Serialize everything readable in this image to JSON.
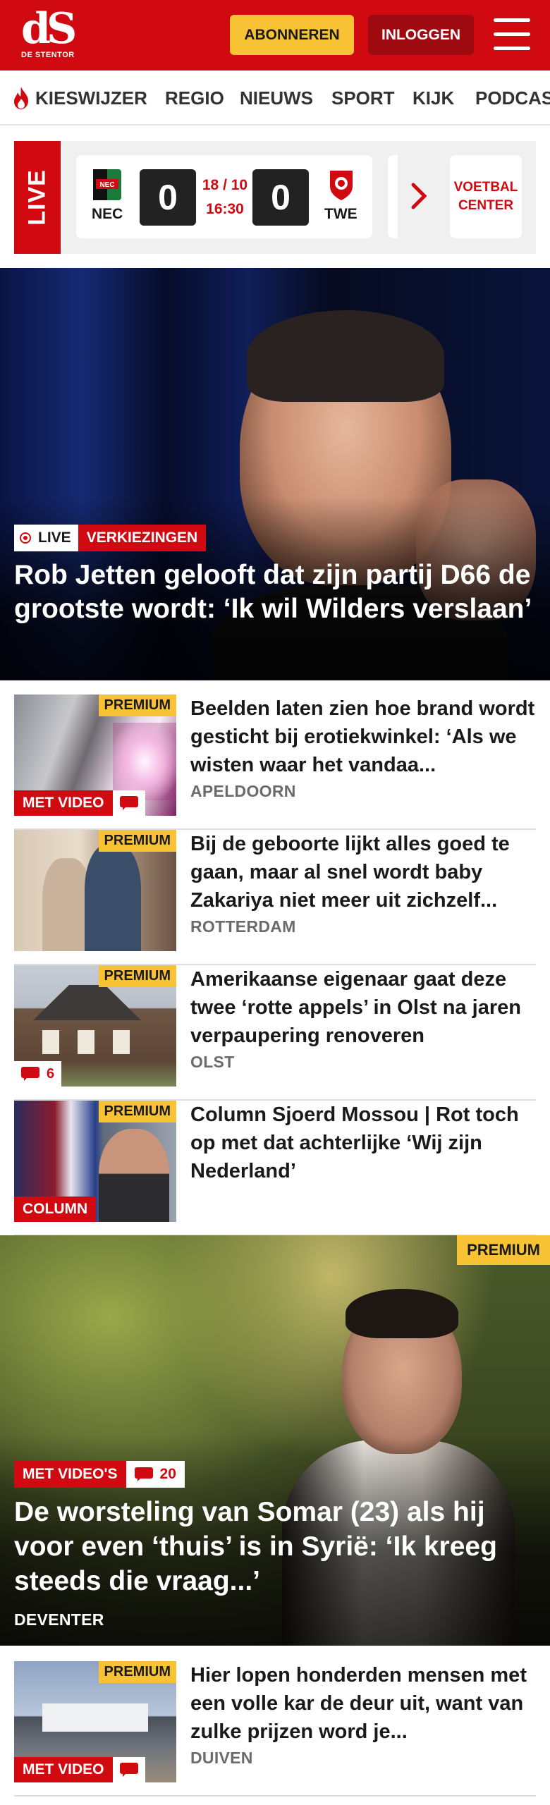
{
  "header": {
    "logo_mark": "dS",
    "logo_name": "DE STENTOR",
    "subscribe_label": "ABONNEREN",
    "login_label": "INLOGGEN",
    "brand_color": "#d10a11",
    "accent_color": "#f7c233"
  },
  "nav": {
    "items": [
      "KIESWIJZER",
      "REGIO",
      "NIEUWS",
      "SPORT",
      "KIJK",
      "PODCASTS"
    ]
  },
  "live": {
    "label": "LIVE",
    "match": {
      "home_team": "NEC",
      "away_team": "TWE",
      "home_score": "0",
      "away_score": "0",
      "date": "18 / 10",
      "time": "16:30"
    },
    "voetbal_center": "VOETBAL CENTER"
  },
  "hero": {
    "live_tag": "LIVE",
    "category": "VERKIEZINGEN",
    "title": "Rob Jetten gelooft dat zijn partij D66 de grootste wordt: ‘Ik wil Wilders verslaan’"
  },
  "articles": [
    {
      "title": "Beelden laten zien hoe brand wordt gesticht bij erotiekwinkel: ‘Als we wisten waar het vandaa...",
      "location": "APELDOORN",
      "premium": "PREMIUM",
      "badge": "MET VIDEO",
      "comments": ""
    },
    {
      "title": "Bij de geboorte lijkt alles goed te gaan, maar al snel wordt baby Zakariya niet meer uit zichzelf...",
      "location": "ROTTERDAM",
      "premium": "PREMIUM",
      "badge": "",
      "comments": ""
    },
    {
      "title": "Amerikaanse eigenaar gaat deze twee ‘rotte appels’ in Olst na jaren verpaupering renoveren",
      "location": "OLST",
      "premium": "PREMIUM",
      "badge": "",
      "comments": "6"
    },
    {
      "title": "Column Sjoerd Mossou | Rot toch op met dat achterlijke ‘Wij zijn Nederland’",
      "location": "",
      "premium": "PREMIUM",
      "badge": "COLUMN",
      "comments": ""
    }
  ],
  "feature": {
    "premium": "PREMIUM",
    "badge": "MET VIDEO'S",
    "comments": "20",
    "title": "De worsteling van Somar (23) als hij voor even ‘thuis’ is in Syrië: ‘Ik kreeg steeds die vraag...’",
    "location": "DEVENTER"
  },
  "article_bottom": {
    "title": "Hier lopen honderden mensen met een volle kar de deur uit, want van zulke prijzen word je...",
    "location": "DUIVEN",
    "premium": "PREMIUM",
    "badge": "MET VIDEO"
  }
}
